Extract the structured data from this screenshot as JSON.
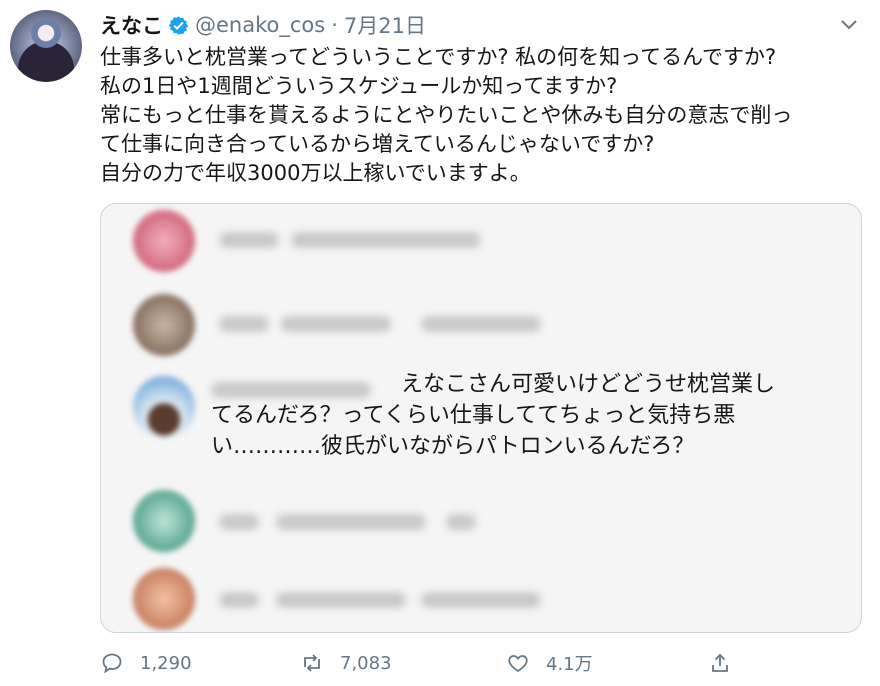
{
  "tweet": {
    "display_name": "えなこ",
    "handle": "@enako_cos",
    "separator": "·",
    "date": "7月21日",
    "lines": [
      "仕事多いと枕営業ってどういうことですか? 私の何を知ってるんですか?",
      "私の1日や1週間どういうスケジュールか知ってますか?",
      "常にもっと仕事を貰えるようにとやりたいことや休みも自分の意志で削っ",
      "て仕事に向き合っているから増えているんじゃないですか?",
      "自分の力で年収3000万以上稼いでいますよ。"
    ]
  },
  "quoted_image": {
    "comment_lines": [
      "えなこさん可愛いけどどうせ枕営業し",
      "てるんだろ？ってくらい仕事しててちょっと気持ち悪",
      "い…………彼氏がいながらパトロンいるんだろ？"
    ]
  },
  "actions": {
    "reply_count": "1,290",
    "retweet_count": "7,083",
    "like_count": "4.1万"
  },
  "icons": {
    "verified": "verified-icon",
    "chevron": "chevron-down-icon",
    "reply": "reply-icon",
    "retweet": "retweet-icon",
    "like": "heart-icon",
    "share": "share-icon"
  },
  "colors": {
    "verified": "#1da1f2",
    "muted": "#657786",
    "text": "#14171a"
  }
}
